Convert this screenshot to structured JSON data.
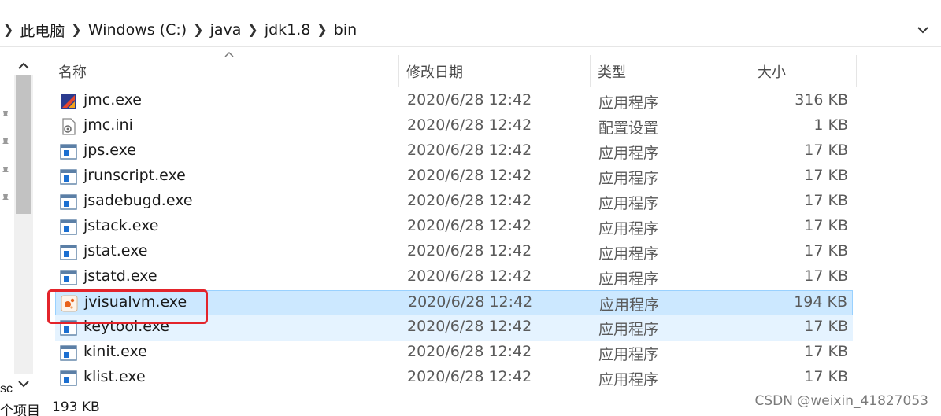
{
  "breadcrumb": {
    "items": [
      "此电脑",
      "Windows (C:)",
      "java",
      "jdk1.8",
      "bin"
    ]
  },
  "columns": {
    "name": "名称",
    "date": "修改日期",
    "type": "类型",
    "size": "大小"
  },
  "files": [
    {
      "name": "jmc.exe",
      "date": "2020/6/28 12:42",
      "type": "应用程序",
      "size": "316 KB",
      "icon": "jmc-app-icon"
    },
    {
      "name": "jmc.ini",
      "date": "2020/6/28 12:42",
      "type": "配置设置",
      "size": "1 KB",
      "icon": "settings-file-icon"
    },
    {
      "name": "jps.exe",
      "date": "2020/6/28 12:42",
      "type": "应用程序",
      "size": "17 KB",
      "icon": "exe-window-icon"
    },
    {
      "name": "jrunscript.exe",
      "date": "2020/6/28 12:42",
      "type": "应用程序",
      "size": "17 KB",
      "icon": "exe-window-icon"
    },
    {
      "name": "jsadebugd.exe",
      "date": "2020/6/28 12:42",
      "type": "应用程序",
      "size": "17 KB",
      "icon": "exe-window-icon"
    },
    {
      "name": "jstack.exe",
      "date": "2020/6/28 12:42",
      "type": "应用程序",
      "size": "17 KB",
      "icon": "exe-window-icon"
    },
    {
      "name": "jstat.exe",
      "date": "2020/6/28 12:42",
      "type": "应用程序",
      "size": "17 KB",
      "icon": "exe-window-icon"
    },
    {
      "name": "jstatd.exe",
      "date": "2020/6/28 12:42",
      "type": "应用程序",
      "size": "17 KB",
      "icon": "exe-window-icon"
    },
    {
      "name": "jvisualvm.exe",
      "date": "2020/6/28 12:42",
      "type": "应用程序",
      "size": "194 KB",
      "icon": "jvisualvm-app-icon"
    },
    {
      "name": "keytool.exe",
      "date": "2020/6/28 12:42",
      "type": "应用程序",
      "size": "17 KB",
      "icon": "exe-window-icon"
    },
    {
      "name": "kinit.exe",
      "date": "2020/6/28 12:42",
      "type": "应用程序",
      "size": "17 KB",
      "icon": "exe-window-icon"
    },
    {
      "name": "klist.exe",
      "date": "2020/6/28 12:42",
      "type": "应用程序",
      "size": "17 KB",
      "icon": "exe-window-icon"
    }
  ],
  "selected_file": "jvisualvm.exe",
  "hovered_file": "keytool.exe",
  "status": {
    "count": "个项目",
    "selected_size": "193 KB"
  },
  "side_text": "sc",
  "watermark": "CSDN @weixin_41827053",
  "colors": {
    "selection_bg": "#cce8ff",
    "selection_border": "#99d1ff",
    "hover_bg": "#e5f3ff",
    "highlight_box": "#e3242b"
  }
}
